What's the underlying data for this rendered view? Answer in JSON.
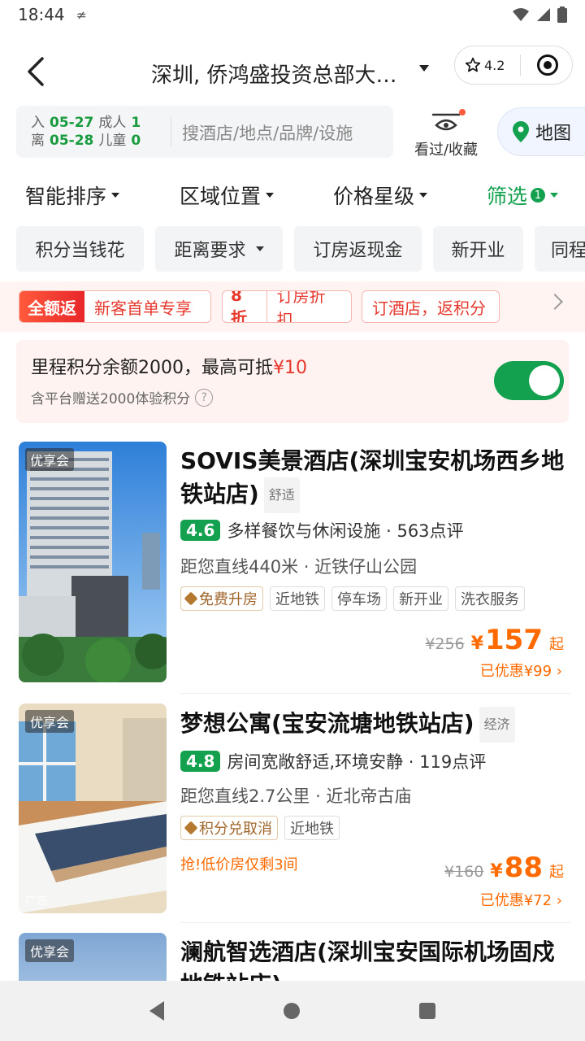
{
  "status": {
    "time": "18:44"
  },
  "header": {
    "title": "深圳, 侨鸿盛投资总部大…",
    "rating": "4.2"
  },
  "search": {
    "checkin_label": "入",
    "checkin_date": "05-27",
    "checkout_label": "离",
    "checkout_date": "05-28",
    "adults_label": "成人",
    "adults": "1",
    "children_label": "儿童",
    "children": "0",
    "placeholder": "搜酒店/地点/品牌/设施",
    "history_label": "看过/收藏",
    "map_label": "地图"
  },
  "sort": {
    "items": [
      "智能排序",
      "区域位置",
      "价格星级",
      "筛选"
    ],
    "filter_count": "1"
  },
  "chips": [
    "积分当钱花",
    "距离要求",
    "订房返现金",
    "新开业",
    "同程"
  ],
  "promos": {
    "p1_tag": "全额返",
    "p1_text": "新客首单专享",
    "p2_tag": "8折",
    "p2_text": "订房折扣",
    "p3_text": "订酒店，返积分"
  },
  "points": {
    "main": "里程积分余额2000，最高可抵",
    "money": "¥10",
    "sub": "含平台赠送2000体验积分",
    "toggle_on": true
  },
  "hotels": [
    {
      "badge": "优享会",
      "name": "SOVIS美景酒店(深圳宝安机场西乡地铁站店)",
      "grade": "舒适",
      "score": "4.6",
      "review_text": "多样餐饮与休闲设施 · 563点评",
      "distance": "距您直线440米 · 近铁仔山公园",
      "perk": "免费升房",
      "tags": [
        "近地铁",
        "停车场",
        "新开业",
        "洗衣服务"
      ],
      "orig_price": "¥256",
      "yen": "¥",
      "price": "157",
      "qi": "起",
      "saved": "已优惠¥99"
    },
    {
      "badge": "优享会",
      "ad": "广告",
      "name": "梦想公寓(宝安流塘地铁站店)",
      "grade": "经济",
      "score": "4.8",
      "review_text": "房间宽敞舒适,环境安静 · 119点评",
      "distance": "距您直线2.7公里 · 近北帝古庙",
      "perk": "积分兑取消",
      "tags": [
        "近地铁"
      ],
      "urgent": "抢!低价房仅剩3间",
      "orig_price": "¥160",
      "yen": "¥",
      "price": "88",
      "qi": "起",
      "saved": "已优惠¥72"
    },
    {
      "badge": "优享会",
      "name": "澜航智选酒店(深圳宝安国际机场固戍地铁站店)"
    }
  ]
}
